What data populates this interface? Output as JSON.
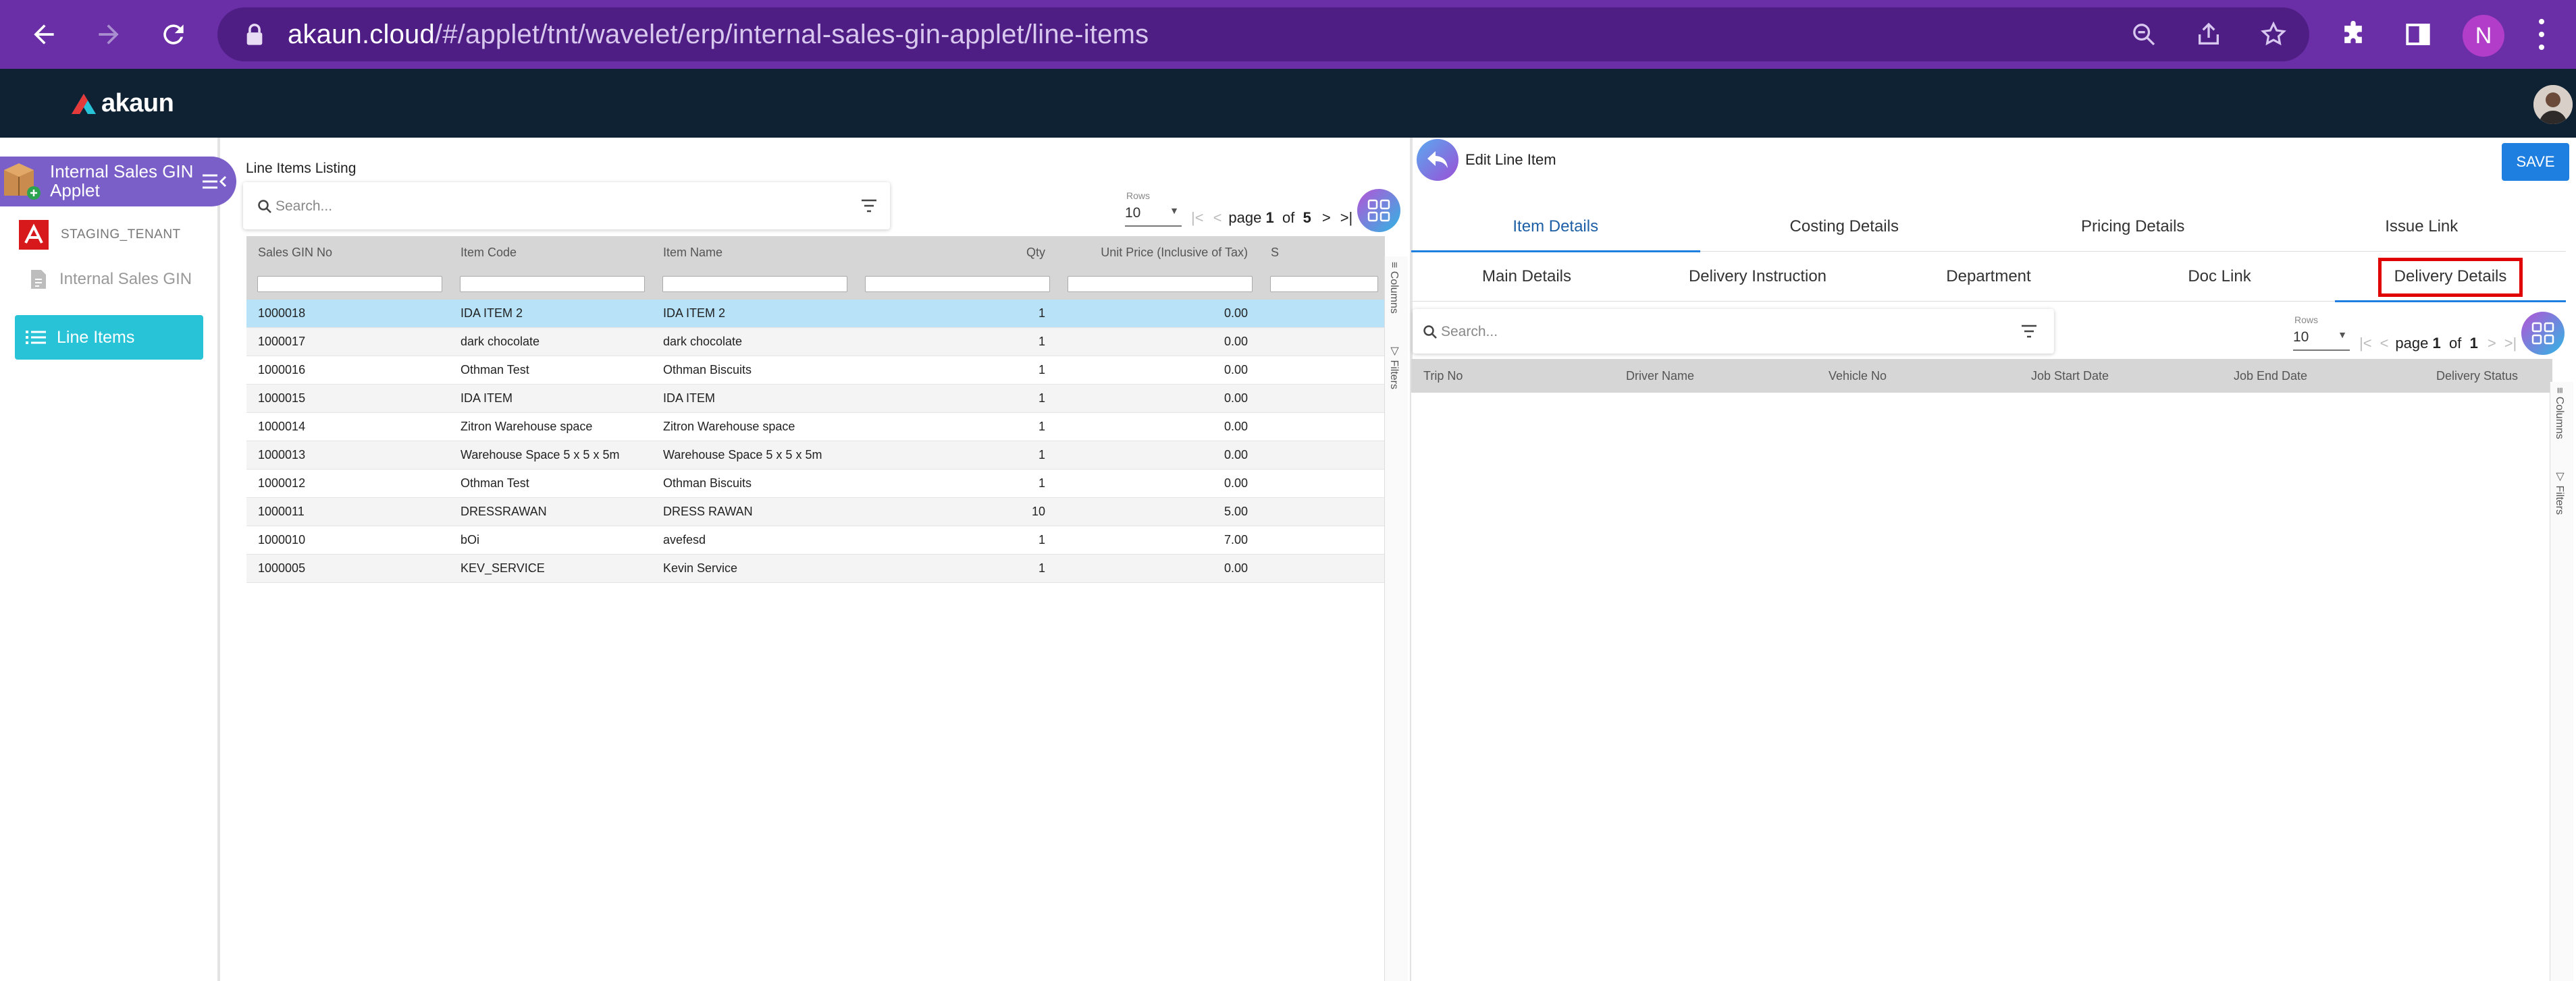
{
  "browser": {
    "url_host": "akaun.cloud",
    "url_path": "/#/applet/tnt/wavelet/erp/internal-sales-gin-applet/line-items",
    "profile_initial": "N"
  },
  "app": {
    "logo_text": "akaun"
  },
  "sidebar": {
    "applet_name": "Internal Sales GIN Applet",
    "tenant": "STAGING_TENANT",
    "items": [
      {
        "label": "Internal Sales GIN",
        "active": false
      },
      {
        "label": "Line Items",
        "active": true
      }
    ]
  },
  "listing": {
    "title": "Line Items Listing",
    "search_placeholder": "Search...",
    "rows_label": "Rows",
    "rows_value": "10",
    "pager": {
      "page_word": "page",
      "current": "1",
      "of_word": "of",
      "total": "5"
    },
    "columns": [
      "Sales GIN No",
      "Item Code",
      "Item Name",
      "Qty",
      "Unit Price (Inclusive of Tax)",
      "S"
    ],
    "rows": [
      [
        "1000018",
        "IDA ITEM 2",
        "IDA ITEM 2",
        "1",
        "0.00"
      ],
      [
        "1000017",
        "dark chocolate",
        "dark chocolate",
        "1",
        "0.00"
      ],
      [
        "1000016",
        "Othman Test",
        "Othman Biscuits",
        "1",
        "0.00"
      ],
      [
        "1000015",
        "IDA ITEM",
        "IDA ITEM",
        "1",
        "0.00"
      ],
      [
        "1000014",
        "Zitron Warehouse space",
        "Zitron Warehouse space",
        "1",
        "0.00"
      ],
      [
        "1000013",
        "Warehouse Space 5 x 5 x 5m",
        "Warehouse Space 5 x 5 x 5m",
        "1",
        "0.00"
      ],
      [
        "1000012",
        "Othman Test",
        "Othman Biscuits",
        "1",
        "0.00"
      ],
      [
        "1000011",
        "DRESSRAWAN",
        "DRESS RAWAN",
        "10",
        "5.00"
      ],
      [
        "1000010",
        "bOi",
        "avefesd",
        "1",
        "7.00"
      ],
      [
        "1000005",
        "KEV_SERVICE",
        "Kevin Service",
        "1",
        "0.00"
      ]
    ],
    "side_tabs": [
      "Columns",
      "Filters"
    ]
  },
  "edit": {
    "title": "Edit Line Item",
    "save_label": "SAVE",
    "tabs_primary": [
      "Item Details",
      "Costing Details",
      "Pricing Details",
      "Issue Link"
    ],
    "tabs_secondary": [
      "Main Details",
      "Delivery Instruction",
      "Department",
      "Doc Link",
      "Delivery Details"
    ],
    "search_placeholder": "Search...",
    "rows_label": "Rows",
    "rows_value": "10",
    "pager": {
      "page_word": "page",
      "current": "1",
      "of_word": "of",
      "total": "1"
    },
    "columns": [
      "Trip No",
      "Driver Name",
      "Vehicle No",
      "Job Start Date",
      "Job End Date",
      "Delivery Status"
    ],
    "side_tabs": [
      "Columns",
      "Filters"
    ]
  },
  "colors": {
    "browser": "#6a2fa6",
    "appbar": "#0f2233",
    "accent": "#29c3d8",
    "primary": "#1e7fe0",
    "highlight": "#e00000"
  }
}
